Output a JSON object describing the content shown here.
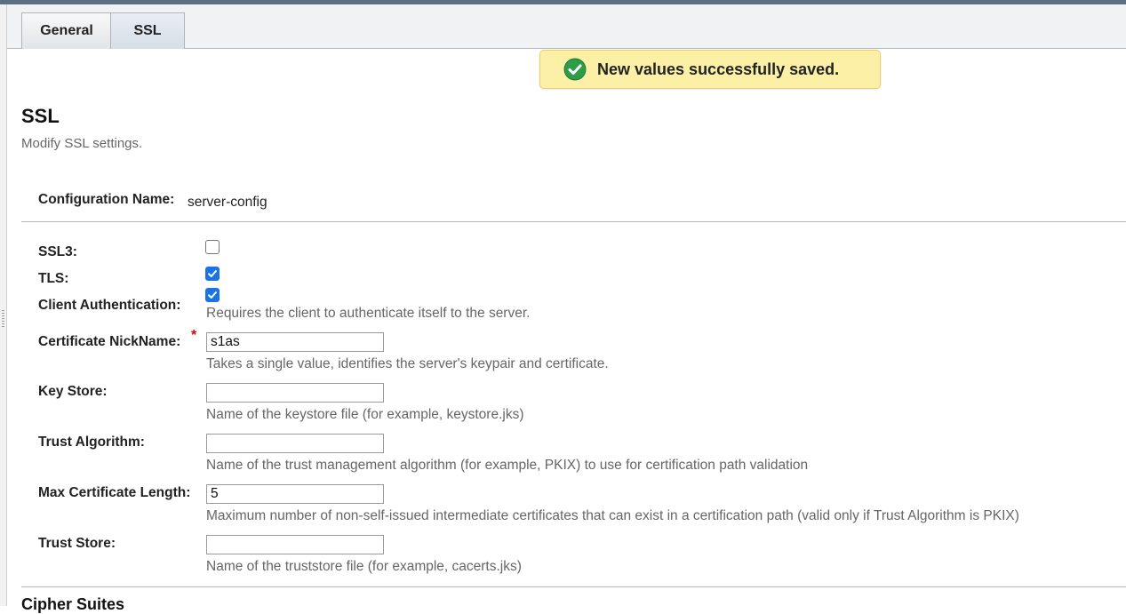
{
  "tabs": [
    {
      "label": "General"
    },
    {
      "label": "SSL"
    }
  ],
  "alert": {
    "message": "New values successfully saved."
  },
  "page": {
    "title": "SSL",
    "help": "Modify SSL settings."
  },
  "config": {
    "label": "Configuration Name:",
    "value": "server-config"
  },
  "fields": {
    "ssl3": {
      "label": "SSL3:",
      "checked": false
    },
    "tls": {
      "label": "TLS:",
      "checked": true
    },
    "client_auth": {
      "label": "Client Authentication:",
      "checked": true,
      "help": "Requires the client to authenticate itself to the server."
    },
    "cert_nickname": {
      "label": "Certificate NickName:",
      "value": "s1as",
      "help": "Takes a single value, identifies the server's keypair and certificate.",
      "required_mark": "*"
    },
    "key_store": {
      "label": "Key Store:",
      "value": "",
      "help": "Name of the keystore file (for example, keystore.jks)"
    },
    "trust_algorithm": {
      "label": "Trust Algorithm:",
      "value": "",
      "help": "Name of the trust management algorithm (for example, PKIX) to use for certification path validation"
    },
    "max_cert_length": {
      "label": "Max Certificate Length:",
      "value": "5",
      "help": "Maximum number of non-self-issued intermediate certificates that can exist in a certification path (valid only if Trust Algorithm is PKIX)"
    },
    "trust_store": {
      "label": "Trust Store:",
      "value": "",
      "help": "Name of the truststore file (for example, cacerts.jks)"
    }
  },
  "next_section": {
    "title": "Cipher Suites"
  },
  "icons": {
    "alert": "success-check-icon",
    "checkbox": "checkmark-icon"
  },
  "colors": {
    "alert_bg": "#fbf0a6",
    "success": "#2e9d48",
    "checkbox": "#1a73e8",
    "required": "#dd0000"
  }
}
